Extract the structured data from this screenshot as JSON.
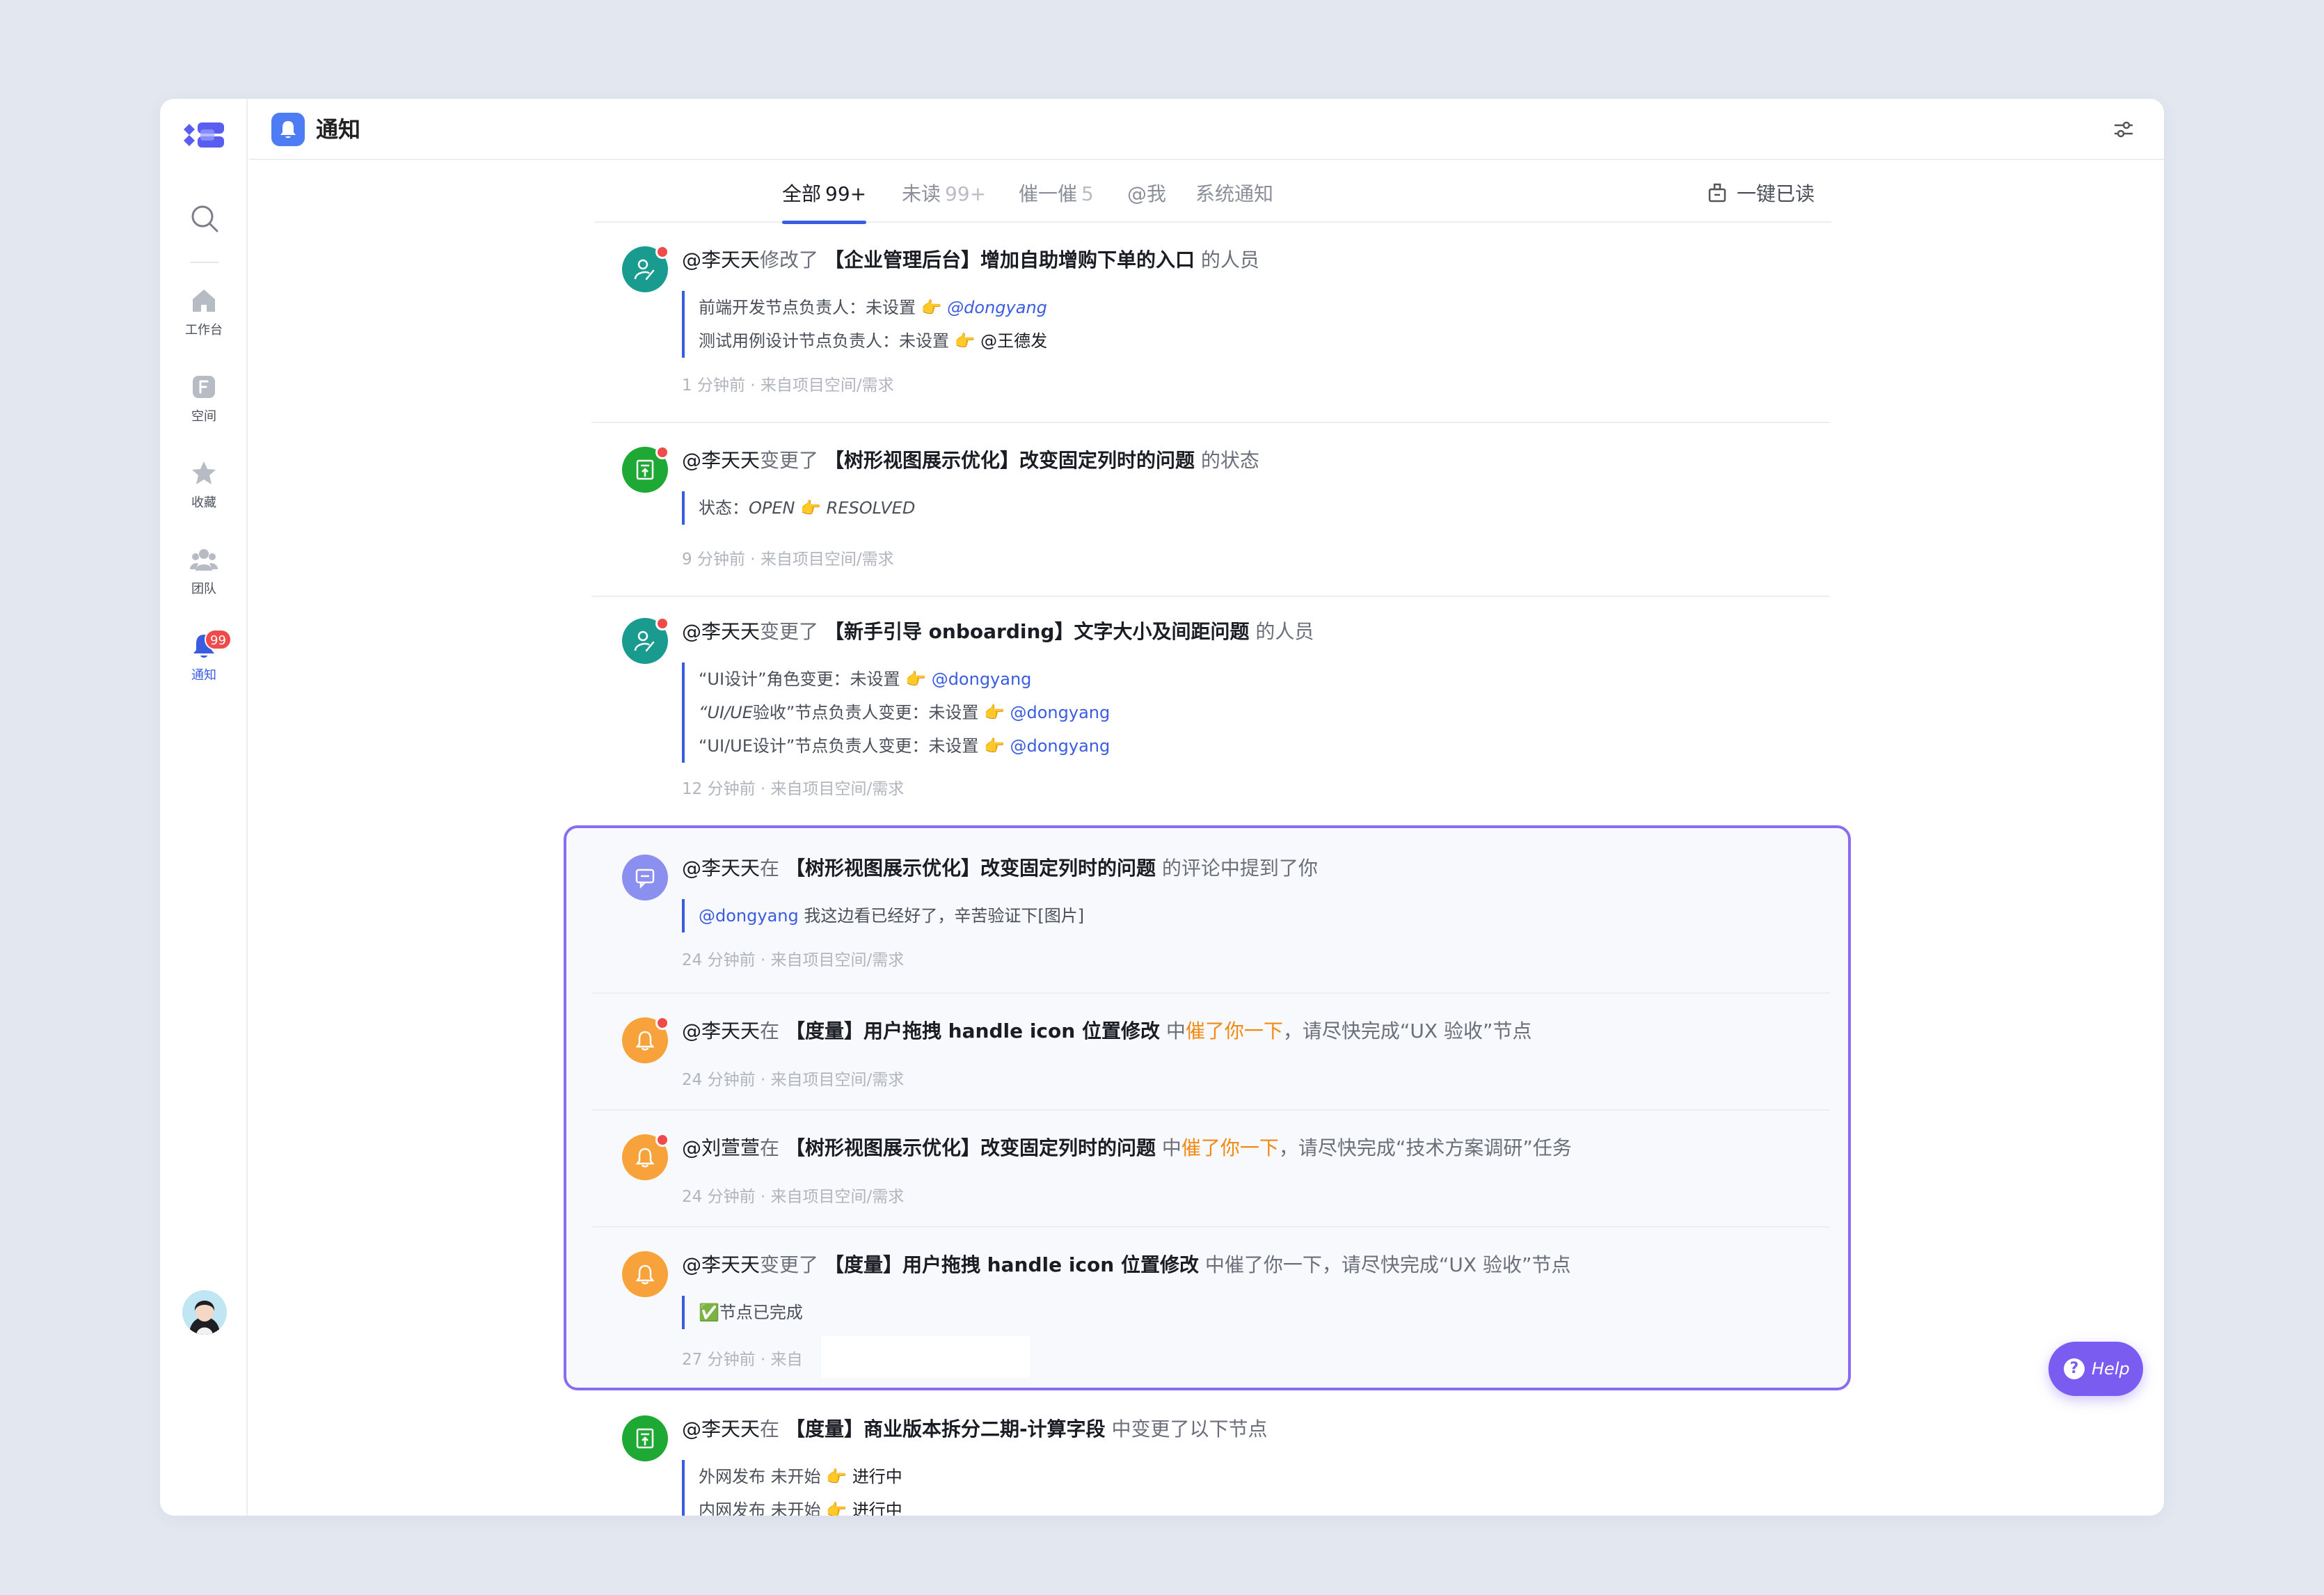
{
  "sidebar": {
    "items": [
      {
        "label": "工作台"
      },
      {
        "label": "空间"
      },
      {
        "label": "收藏"
      },
      {
        "label": "团队"
      },
      {
        "label": "通知",
        "badge": "99"
      }
    ]
  },
  "header": {
    "title": "通知"
  },
  "tabs": [
    {
      "label": "全部",
      "count": "99+"
    },
    {
      "label": "未读",
      "count": "99+"
    },
    {
      "label": "催一催",
      "count": "5"
    },
    {
      "label": "@我",
      "count": ""
    },
    {
      "label": "系统通知",
      "count": ""
    }
  ],
  "mark_all_read": "一键已读",
  "feed": [
    {
      "actor": "@李天天",
      "verb": "修改了",
      "target": "【企业管理后台】增加自助增购下单的入口",
      "suffix": "的人员",
      "lines": [
        {
          "text": "前端开发节点负责人：未设置",
          "arrow": "👉",
          "value": "@dongyang"
        },
        {
          "text": "测试用例设计节点负责人：未设置",
          "arrow": "👉",
          "value": "@王德发"
        }
      ],
      "meta": "1 分钟前 · 来自项目空间/需求"
    },
    {
      "actor": "@李天天",
      "verb": "变更了",
      "target": "【树形视图展示优化】改变固定列时的问题",
      "suffix": "的状态",
      "lines": [
        {
          "text": "状态：",
          "from": "OPEN",
          "arrow": "👉",
          "value": "RESOLVED"
        }
      ],
      "meta": "9 分钟前 · 来自项目空间/需求"
    },
    {
      "actor": "@李天天",
      "verb": "变更了",
      "target": "【新手引导 onboarding】文字大小及间距问题",
      "suffix": "的人员",
      "lines": [
        {
          "text": "“UI设计”角色变更：未设置",
          "arrow": "👉",
          "value": "@dongyang"
        },
        {
          "text_italic": "“UI/UE",
          "text": "验收”节点负责人变更：未设置",
          "arrow": "👉",
          "value": "@dongyang"
        },
        {
          "text": "“UI/UE设计”节点负责人变更：未设置",
          "arrow": "👉",
          "value": "@dongyang"
        }
      ],
      "meta": "12 分钟前 · 来自项目空间/需求"
    },
    {
      "actor": "@李天天",
      "verb": "在",
      "target": "【树形视图展示优化】改变固定列时的问题",
      "suffix": "的评论中提到了你",
      "lines": [
        {
          "mention": "@dongyang",
          "text": "我这边看已经好了，辛苦验证下[图片]"
        }
      ],
      "meta": "24 分钟前 · 来自项目空间/需求"
    },
    {
      "actor": "@李天天",
      "verb": "在",
      "target": "【度量】用户拖拽 handle icon 位置修改",
      "mid": "中",
      "urge": "催了你一下",
      "suffix": "，请尽快完成“UX 验收”节点",
      "meta": "24 分钟前 · 来自项目空间/需求"
    },
    {
      "actor": "@刘萱萱",
      "verb": "在",
      "target": "【树形视图展示优化】改变固定列时的问题",
      "mid": "中",
      "urge": "催了你一下",
      "suffix": "，请尽快完成“技术方案调研”任务",
      "meta": "24 分钟前 · 来自项目空间/需求"
    },
    {
      "actor": "@李天天",
      "verb": "变更了",
      "target": "【度量】用户拖拽 handle icon 位置修改",
      "suffix": "中催了你一下，请尽快完成“UX 验收”节点",
      "lines": [
        {
          "text": "✅节点已完成"
        }
      ],
      "meta": "27 分钟前 · 来自"
    },
    {
      "actor": "@李天天",
      "verb": "在",
      "target": "【度量】商业版本拆分二期-计算字段",
      "suffix": "中变更了以下节点",
      "lines": [
        {
          "text": "外网发布",
          "from": "未开始",
          "arrow": "👉",
          "value": "进行中"
        },
        {
          "text": "内网发布",
          "from": "未开始",
          "arrow": "👉",
          "value": "进行中"
        }
      ]
    }
  ],
  "help": {
    "label": "Help",
    "icon": "?"
  },
  "colors": {
    "accent": "#3a5ce0",
    "urge": "#f08a13",
    "highlight_border": "#8a6cf0",
    "badge": "#f04a4a"
  }
}
